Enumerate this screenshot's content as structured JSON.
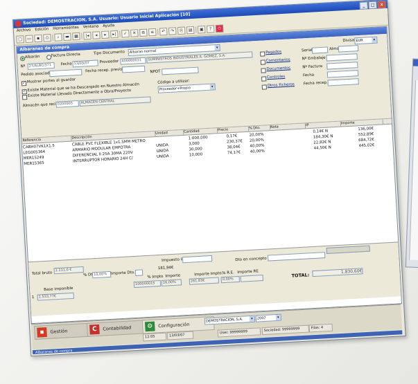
{
  "app": {
    "title": "Sociedad: DEMOSTRACION, S.A. Usuario: Usuario Inicial Aplicación [10]",
    "window_buttons": [
      "_",
      "□",
      "x"
    ]
  },
  "menu": [
    "Archivo",
    "Edición",
    "Herramientas",
    "Ventana",
    "Ayuda"
  ],
  "document": {
    "title": "Albaranes de compra",
    "doc_kind": {
      "albaran": "Albarán",
      "factura_directa": "Factura Directa"
    },
    "tipo_documento_label": "Tipo Documento",
    "tipo_documento_value": "Albaran normal",
    "n_label": "Nº",
    "n_value": "27/ALBC/371",
    "fecha_label": "Fecha",
    "fecha_value": "13/03/07",
    "proveedor_label": "Proveedor",
    "proveedor_code": "400000031",
    "proveedor_name": "SUMINISTROS INDUSTRIALES A. GOMEZ, S.A.",
    "pedido_asociado_label": "Pedido asociado",
    "fecha_recep_label": "Fecha recep. prevista",
    "npot_label": "NPOT",
    "mostrar_portes_label": "Mostrar portes al guardar",
    "check_descargado_label": "Existe Material que se ha Descargado en Nuestro Almacén",
    "check_directo_label": "Existe Material Llevado Directamente a Obra/Proyecto",
    "codigo_utilizar_label": "Código a utilizar:",
    "codigo_utilizar_value": "Proveedor+Propio",
    "almacen_label": "Almacén que recibe",
    "almacen_code": "0200005",
    "almacen_name": "ALMACEN CENTRAL",
    "divisa_label": "Divisa",
    "divisa_value": "EUR",
    "options": [
      "Pagados",
      "Comentarios",
      "Documentos",
      "Controles",
      "Otros Ficheros"
    ],
    "serial_label": "Serial",
    "alma_label": "Alma",
    "n_embalaje_label": "Nº Embalaje",
    "n_factura_label": "Nº Factura",
    "fecha_right_label": "Fecha",
    "fecha_recep_right_label": "Fecha recep."
  },
  "grid": {
    "columns": [
      "Referencia",
      "Descripción",
      "Unidad",
      "Cantidad",
      "Precio",
      "% Dto.",
      "Nota",
      "IP",
      "Importe"
    ],
    "rows": [
      {
        "ref": "CABH07VK1X1.5",
        "desc": "CABLE PVC FLEXIBLE 1x1.5MM METRO",
        "unit": "",
        "qty": "1.000,000",
        "price": "0,17€",
        "dto": "20,00%",
        "ip": "0,14€ N",
        "importe": "136,00€"
      },
      {
        "ref": "LEG005364",
        "desc": "ARMARIO MODULAR EMPOTRA",
        "unit": "UNIDA",
        "qty": "3,000",
        "price": "230,37€",
        "dto": "20,00%",
        "ip": "184,30€ N",
        "importe": "552,89€"
      },
      {
        "ref": "MER15249",
        "desc": "DIFERENCIAL II 25A 30MA 220V",
        "unit": "UNIDA",
        "qty": "30,000",
        "price": "38,04€",
        "dto": "40,00%",
        "ip": "22,82€ N",
        "importe": "684,72€"
      },
      {
        "ref": "MER15365",
        "desc": "INTERRUPTOR HORARIO 24H C/",
        "unit": "UNIDA",
        "qty": "10,000",
        "price": "74,17€",
        "dto": "40,00%",
        "ip": "44,50€ N",
        "importe": "445,02€"
      }
    ]
  },
  "totals": {
    "total_bruto_label": "Total bruto",
    "total_bruto_value": "1.111,0 €",
    "dto_label": "% Dto",
    "dto_value": "10,00%",
    "importe_dto_label": "Importe Dto.",
    "importe_label": "Importe",
    "impuesto_lasos_label": "Impuesto lasos",
    "dto_concepto_label": "Dto en concepto de",
    "base_imponible_label": "Base imponible",
    "base_imponible_value": "1.533,77€",
    "pct_impto_label": "% Impto",
    "impuesto_value": "181,94€",
    "cuota_label": "Importe Impto.",
    "cuota_value": "261,83€",
    "re_label": "% R.E.",
    "importe_re_label": "Importe RE",
    "row_code": "100000015",
    "row_pct": "16,00%",
    "re_value": "0,00%",
    "total_label": "TOTAL:",
    "total_value": "1.830,60€",
    "small_code": "1"
  },
  "taskbar": {
    "gestion": "Gestión",
    "contabilidad": "Contabilidad",
    "configuracion": "Configuración",
    "company_select": "DEMOSTRACION, S.A.",
    "year_select": "2007",
    "time": "12:05",
    "date": "13/03/07",
    "user": "User: 99999999",
    "sociedad": "Sociedad: 99999999",
    "filas": "Filas: 4",
    "footer": "Albaranes de compra"
  }
}
